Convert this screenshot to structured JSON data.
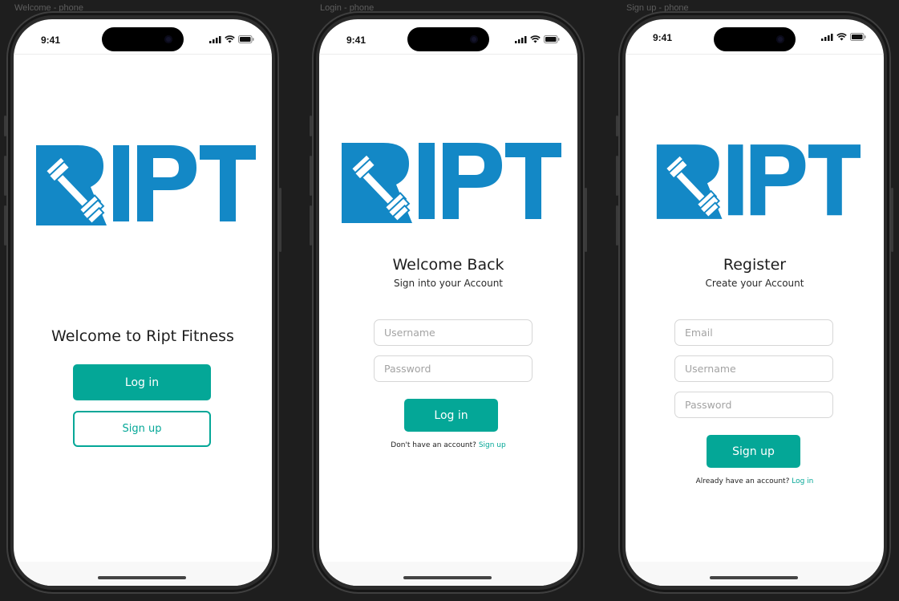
{
  "colors": {
    "accent": "#04a797",
    "logo_blue": "#1388c6",
    "canvas": "#1e1e1e"
  },
  "frames": {
    "welcome": {
      "label": "Welcome - phone",
      "time": "9:41",
      "heading": "Welcome to Ript Fitness",
      "login_label": "Log in",
      "signup_label": "Sign up"
    },
    "login": {
      "label": "Login - phone",
      "time": "9:41",
      "title": "Welcome Back",
      "subtitle": "Sign into your Account",
      "username_placeholder": "Username",
      "password_placeholder": "Password",
      "login_label": "Log in",
      "footer_text": "Don't have an account?",
      "footer_link": "Sign up"
    },
    "signup": {
      "label": "Sign up - phone",
      "time": "9:41",
      "title": "Register",
      "subtitle": "Create your Account",
      "email_placeholder": "Email",
      "username_placeholder": "Username",
      "password_placeholder": "Password",
      "signup_label": "Sign up",
      "footer_text": "Already have an account?",
      "footer_link": "Log in"
    }
  },
  "icons": {
    "logo": "ript-logo-barbell",
    "status": [
      "signal-icon",
      "wifi-icon",
      "battery-icon"
    ]
  }
}
